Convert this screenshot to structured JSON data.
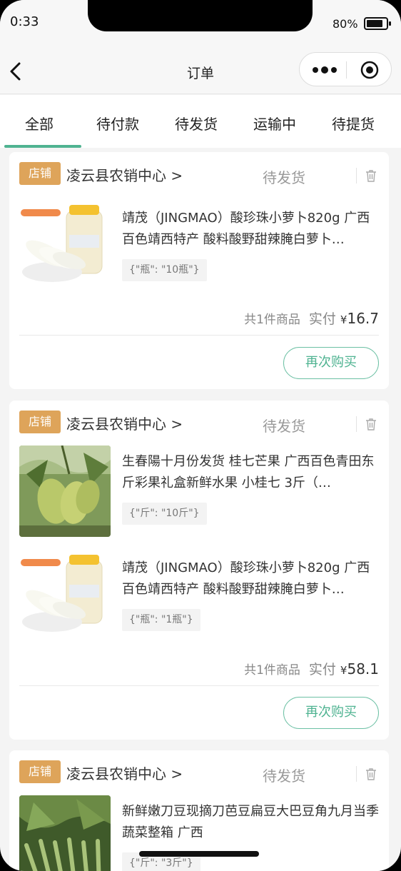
{
  "status_bar": {
    "time": "0:33",
    "battery": "80%"
  },
  "nav": {
    "title": "订单"
  },
  "tabs": [
    {
      "label": "全部",
      "active": true
    },
    {
      "label": "待付款",
      "active": false
    },
    {
      "label": "待发货",
      "active": false
    },
    {
      "label": "运输中",
      "active": false
    },
    {
      "label": "待提货",
      "active": false
    }
  ],
  "orders": [
    {
      "badge": "店铺",
      "shop": "凌云县农销中心 >",
      "status": "待发货",
      "items": [
        {
          "title": "靖茂（JINGMAO）酸珍珠小萝卜820g 广西百色靖西特产 酸料酸野甜辣腌白萝卜…",
          "spec": "{\"瓶\": \"10瓶\"}"
        }
      ],
      "count": "共1件商品",
      "paid_label": "实付",
      "currency": "¥",
      "amount": "16.7",
      "button": "再次购买"
    },
    {
      "badge": "店铺",
      "shop": "凌云县农销中心 >",
      "status": "待发货",
      "items": [
        {
          "title": "生春陽十月份发货 桂七芒果 广西百色青田东斤彩果礼盒新鲜水果 小桂七 3斤（…",
          "spec": "{\"斤\": \"10斤\"}"
        },
        {
          "title": "靖茂（JINGMAO）酸珍珠小萝卜820g 广西百色靖西特产 酸料酸野甜辣腌白萝卜…",
          "spec": "{\"瓶\": \"1瓶\"}"
        }
      ],
      "count": "共1件商品",
      "paid_label": "实付",
      "currency": "¥",
      "amount": "58.1",
      "button": "再次购买"
    },
    {
      "badge": "店铺",
      "shop": "凌云县农销中心 >",
      "status": "待发货",
      "items": [
        {
          "title": "新鲜嫩刀豆现摘刀芭豆扁豆大巴豆角九月当季蔬菜整箱 广西",
          "spec": "{\"斤\": \"3斤\"}"
        }
      ]
    }
  ],
  "colors": {
    "accent": "#4fb391",
    "badge": "#dea45a",
    "background": "#f4f4f4"
  },
  "icons": [
    "back-icon",
    "more-icon",
    "target-icon",
    "trash-icon"
  ]
}
